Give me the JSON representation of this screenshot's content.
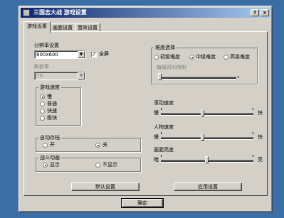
{
  "window": {
    "title": "三国志大战 游戏设置"
  },
  "tabs": [
    {
      "label": "游戏设置",
      "active": true
    },
    {
      "label": "画面设置",
      "active": false
    },
    {
      "label": "音效设置",
      "active": false
    }
  ],
  "display": {
    "resolution_label": "分辨率设置",
    "resolution_value": "800x600",
    "fullscreen_label": "全屏",
    "fullscreen_checked": true,
    "refresh_label": "刷新率",
    "refresh_value": "75"
  },
  "game_speed": {
    "group_label": "游戏速度",
    "options": [
      "慢",
      "普通",
      "快速",
      "极快"
    ],
    "selected_index": 0
  },
  "auto_save": {
    "group_label": "自动存档",
    "options": [
      "开",
      "关"
    ],
    "selected_index": 1
  },
  "battle_anim": {
    "group_label": "战斗动画",
    "options": [
      "显示",
      "不显示"
    ],
    "selected_index": 0
  },
  "difficulty": {
    "group_label": "难度选择",
    "options": [
      "初级难度",
      "中级难度",
      "高级难度"
    ],
    "selected_index": 1,
    "slider_label": "每局时间限制",
    "slider_value": 0
  },
  "sliders": [
    {
      "label": "滚动速度",
      "min_label": "慢",
      "max_label": "快",
      "value": 0.45
    },
    {
      "label": "人物速度",
      "min_label": "慢",
      "max_label": "快",
      "value": 0.45
    },
    {
      "label": "画面亮度",
      "min_label": "暗",
      "max_label": "亮",
      "value": 0.5
    }
  ],
  "buttons": {
    "defaults": "默认设置",
    "apply": "应用设置",
    "ok": "确定"
  }
}
